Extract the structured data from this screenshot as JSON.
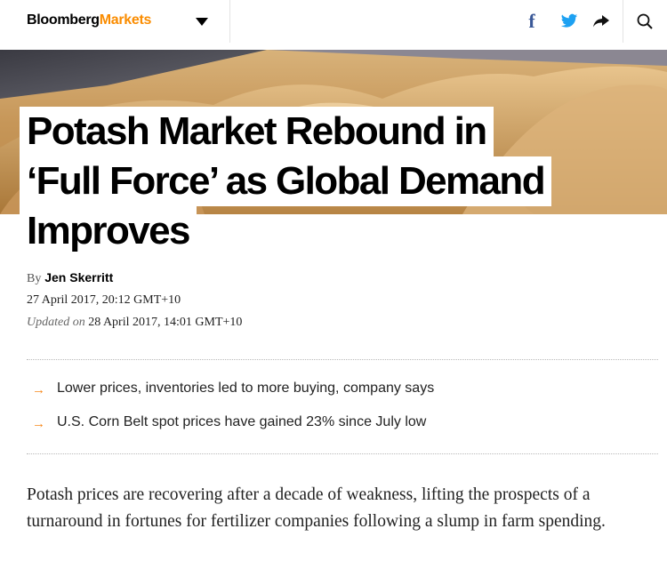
{
  "header": {
    "brand_part1": "Bloomberg",
    "brand_part2": "Markets",
    "icons": [
      "facebook-icon",
      "twitter-icon",
      "share-icon",
      "search-icon"
    ],
    "facebook_glyph": "f"
  },
  "article": {
    "headline_lines": [
      "Potash Market Rebound in",
      "‘Full Force’ as Global Demand",
      "Improves"
    ],
    "byline_prefix": "By",
    "author": "Jen Skerritt",
    "published": "27 April 2017, 20:12 GMT+10",
    "updated_label": "Updated on",
    "updated": "28 April 2017, 14:01 GMT+10",
    "bullets": [
      "Lower prices, inventories led to more buying, company says",
      "U.S. Corn Belt spot prices have gained 23% since July low"
    ],
    "bullet_glyph": "→",
    "body": "Potash prices are recovering after a decade of weakness, lifting the prospects of a turnaround in fortunes for fertilizer companies following a slump in farm spending."
  },
  "colors": {
    "brand_accent": "#fa8c00",
    "bullet_arrow": "#f78a1d",
    "facebook": "#3b5998",
    "twitter": "#1da1f2"
  }
}
